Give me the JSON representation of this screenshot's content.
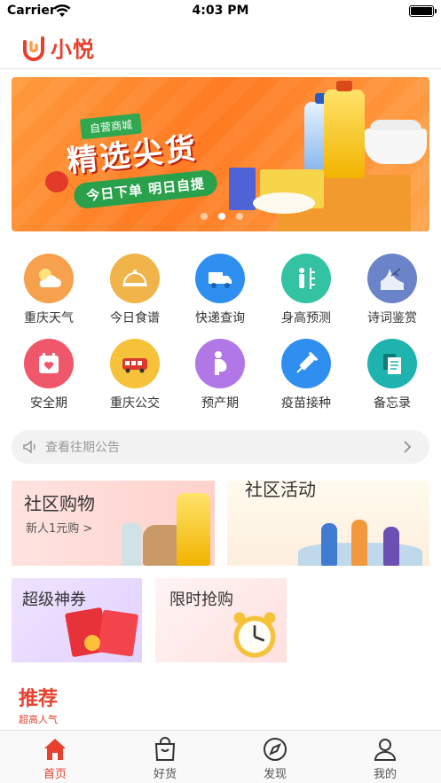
{
  "status_bar": {
    "carrier": "Carrier",
    "time": "4:03 PM"
  },
  "header": {
    "brand": "小悦",
    "accent_color": "#e8402f"
  },
  "banner": {
    "tag": "自营商城",
    "title": "精选尖货",
    "subtitle": "今日下单 明日自提",
    "dots": 3,
    "active_dot": 1
  },
  "grid": {
    "items": [
      {
        "label": "重庆天气",
        "icon": "weather-icon",
        "color": "#f7a04d"
      },
      {
        "label": "今日食谱",
        "icon": "recipe-icon",
        "color": "#f0b44a"
      },
      {
        "label": "快递查询",
        "icon": "delivery-truck-icon",
        "color": "#2f8ff0"
      },
      {
        "label": "身高预测",
        "icon": "height-icon",
        "color": "#33c3a3"
      },
      {
        "label": "诗词鉴赏",
        "icon": "poetry-icon",
        "color": "#6b84c9"
      },
      {
        "label": "安全期",
        "icon": "calendar-heart-icon",
        "color": "#f0576a"
      },
      {
        "label": "重庆公交",
        "icon": "bus-icon",
        "color": "#f5c23a"
      },
      {
        "label": "预产期",
        "icon": "pregnancy-icon",
        "color": "#b277e6"
      },
      {
        "label": "疫苗接种",
        "icon": "vaccine-icon",
        "color": "#2f8ff0"
      },
      {
        "label": "备忘录",
        "icon": "memo-icon",
        "color": "#1fb3b0"
      }
    ]
  },
  "notice": {
    "text": "查看往期公告"
  },
  "promos": {
    "community_shop": {
      "title": "社区购物",
      "sub": "新人1元购 >"
    },
    "community_event": {
      "title": "社区活动"
    },
    "super_coupon": {
      "title": "超级神券"
    },
    "flash_sale": {
      "title": "限时抢购"
    }
  },
  "recommend": {
    "title": "推荐",
    "sub": "超高人气"
  },
  "tabbar": {
    "items": [
      {
        "label": "首页",
        "icon": "home-icon",
        "active": true
      },
      {
        "label": "好货",
        "icon": "shopping-bag-icon",
        "active": false
      },
      {
        "label": "发现",
        "icon": "compass-icon",
        "active": false
      },
      {
        "label": "我的",
        "icon": "user-icon",
        "active": false
      }
    ]
  }
}
